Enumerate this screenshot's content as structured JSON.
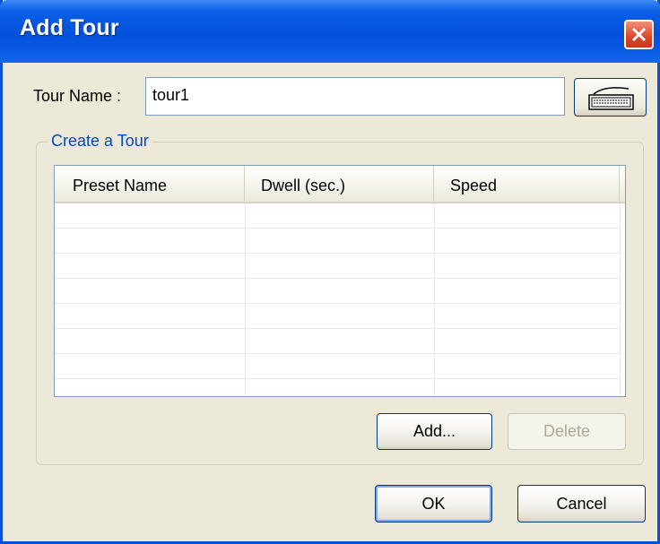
{
  "window": {
    "title": "Add Tour"
  },
  "form": {
    "tour_name_label": "Tour Name :",
    "tour_name_value": "tour1"
  },
  "group": {
    "title": "Create a Tour",
    "columns": [
      "Preset Name",
      "Dwell (sec.)",
      "Speed"
    ],
    "rows": []
  },
  "buttons": {
    "add": "Add...",
    "delete": "Delete",
    "ok": "OK",
    "cancel": "Cancel"
  },
  "icons": {
    "close": "close-icon",
    "keyboard": "keyboard-icon"
  },
  "colors": {
    "titlebar": "#0550dc",
    "group_title": "#0046d5",
    "close_button": "#d8472a"
  }
}
